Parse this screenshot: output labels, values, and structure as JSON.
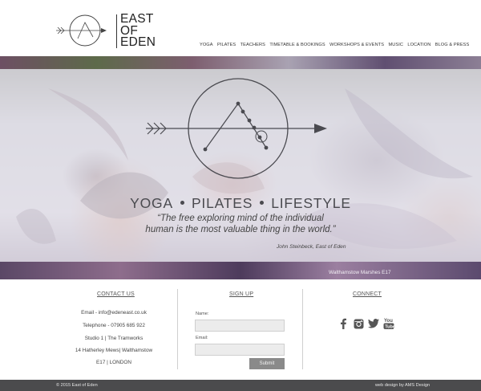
{
  "header": {
    "logo_line1": "EAST",
    "logo_line2": "OF",
    "logo_line3": "EDEN",
    "nav": [
      "YOGA",
      "PILATES",
      "TEACHERS",
      "TIMETABLE & BOOKINGS",
      "WORKSHOPS & EVENTS",
      "MUSIC",
      "LOCATION",
      "BLOG & PRESS"
    ]
  },
  "hero": {
    "heading_words": [
      "YOGA",
      "PILATES",
      "LIFESTYLE"
    ],
    "quote_line1": "“The free exploring mind of the individual",
    "quote_line2": "human is the most valuable thing in the world.”",
    "cite": "John Steinbeck, East of Eden",
    "caption": "Walthamstow Marshes E17"
  },
  "contact": {
    "title": "CONTACT US",
    "lines": [
      "Email - info@edeneast.co.uk",
      "Telephone - 07905 685 922",
      "Studio 1 | The Tramworks",
      "14 Hatherley Mews| Walthamstow",
      "E17 | LONDON"
    ]
  },
  "signup": {
    "title": "SIGN UP",
    "name_label": "Name:",
    "email_label": "Email:",
    "name_value": "",
    "email_value": "",
    "submit_label": "Submit"
  },
  "connect": {
    "title": "CONNECT",
    "icons": [
      "facebook-icon",
      "instagram-icon",
      "twitter-icon",
      "youtube-icon"
    ]
  },
  "footer": {
    "copyright": "© 2015 East of Eden",
    "credit": "web design by AMS Design"
  },
  "colors": {
    "bottom_bar": "#4b4b4d",
    "submit_button": "#8a8a8a",
    "hero_accent": "#6d4f63"
  }
}
